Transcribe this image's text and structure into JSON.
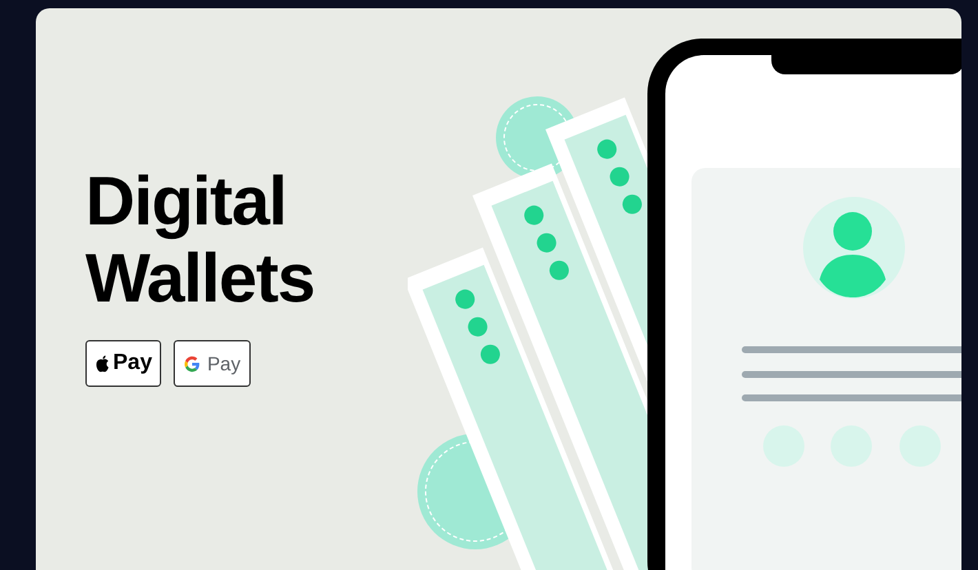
{
  "card": {
    "title": "Digital Wallets",
    "badges": [
      {
        "kind": "apple",
        "label": "Pay"
      },
      {
        "kind": "google",
        "label": "Pay"
      }
    ]
  }
}
